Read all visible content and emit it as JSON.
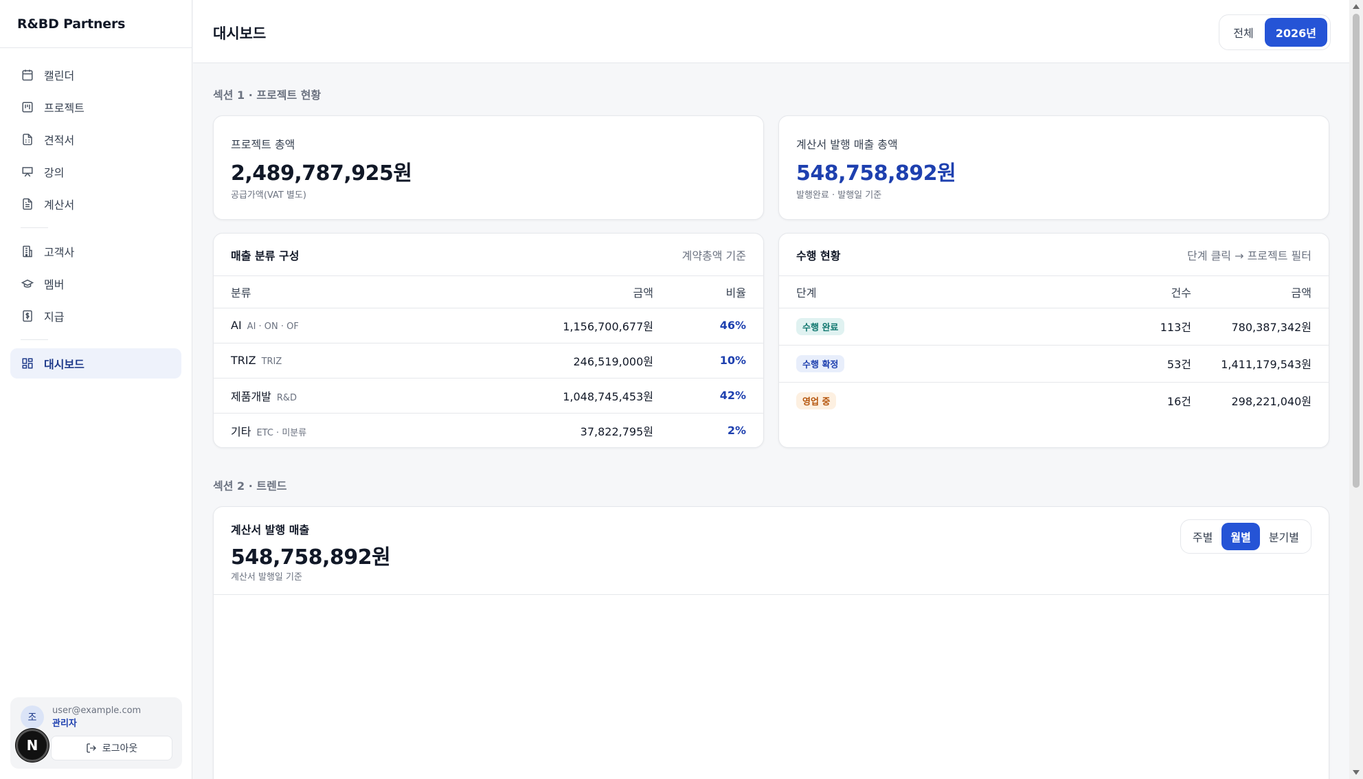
{
  "app": {
    "brand": "R&BD Partners"
  },
  "sidebar": {
    "items": [
      {
        "label": "캘린더",
        "icon": "calendar-icon"
      },
      {
        "label": "프로젝트",
        "icon": "project-icon"
      },
      {
        "label": "견적서",
        "icon": "document-icon"
      },
      {
        "label": "강의",
        "icon": "presentation-icon"
      },
      {
        "label": "계산서",
        "icon": "invoice-icon"
      },
      {
        "label": "고객사",
        "icon": "building-icon"
      },
      {
        "label": "멤버",
        "icon": "graduation-cap-icon"
      },
      {
        "label": "지급",
        "icon": "dollar-receipt-icon"
      },
      {
        "label": "대시보드",
        "icon": "dashboard-icon",
        "active": true
      }
    ],
    "user": {
      "avatar": "조",
      "email": "user@example.com",
      "role": "관리자",
      "logout": "로그아웃"
    },
    "badge": "N"
  },
  "header": {
    "title": "대시보드",
    "year_filter": {
      "options": [
        "전체",
        "2026년"
      ],
      "selected": "2026년"
    }
  },
  "section1": {
    "title": "섹션 1 · 프로젝트 현황",
    "project_total": {
      "label": "프로젝트 총액",
      "value": "2,489,787,925원",
      "sub": "공급가액(VAT 별도)"
    },
    "invoice_total": {
      "label": "계산서 발행 매출 총액",
      "value": "548,758,892원",
      "sub": "발행완료 · 발행일 기준"
    },
    "revenue_breakdown": {
      "title": "매출 분류 구성",
      "hint": "계약총액 기준",
      "columns": [
        "분류",
        "금액",
        "비율"
      ],
      "rows": [
        {
          "name": "AI",
          "sub": "AI · ON · OF",
          "amount": "1,156,700,677원",
          "ratio": "46%"
        },
        {
          "name": "TRIZ",
          "sub": "TRIZ",
          "amount": "246,519,000원",
          "ratio": "10%"
        },
        {
          "name": "제품개발",
          "sub": "R&D",
          "amount": "1,048,745,453원",
          "ratio": "42%"
        },
        {
          "name": "기타",
          "sub": "ETC · 미분류",
          "amount": "37,822,795원",
          "ratio": "2%"
        }
      ]
    },
    "performance": {
      "title": "수행 현황",
      "hint": "단계 클릭 → 프로젝트 필터",
      "columns": [
        "단계",
        "건수",
        "금액"
      ],
      "rows": [
        {
          "stage": "수행 완료",
          "count": "113건",
          "amount": "780,387,342원",
          "bg": "#e0f2f1",
          "fg": "#0f766e"
        },
        {
          "stage": "수행 확정",
          "count": "53건",
          "amount": "1,411,179,543원",
          "bg": "#e8eefb",
          "fg": "#1e40af"
        },
        {
          "stage": "영업 중",
          "count": "16건",
          "amount": "298,221,040원",
          "bg": "#fdf0e1",
          "fg": "#b45309"
        }
      ]
    }
  },
  "section2": {
    "title": "섹션 2 · 트렌드",
    "trend": {
      "label": "계산서 발행 매출",
      "value": "548,758,892원",
      "sub": "계산서 발행일 기준",
      "period": {
        "options": [
          "주별",
          "월별",
          "분기별"
        ],
        "selected": "월별"
      }
    }
  },
  "colors": {
    "accent": "#2554d6",
    "accent_text": "#1e40af",
    "active_nav_bg": "#eef2fb"
  }
}
